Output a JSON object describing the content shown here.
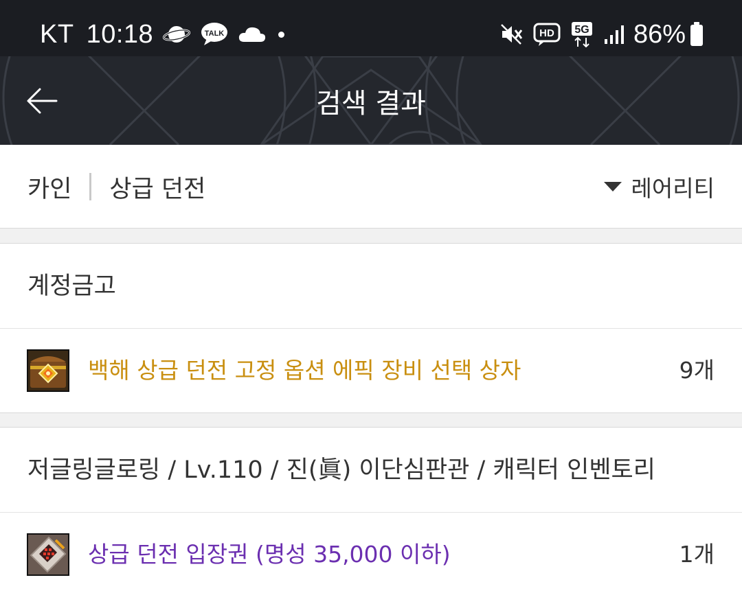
{
  "status_bar": {
    "carrier": "KT",
    "time": "10:18",
    "left_icons": [
      "planet-icon",
      "kakaotalk-icon",
      "cloud-icon"
    ],
    "kakao_label": "TALK",
    "right_icons": [
      "mute-icon",
      "hd-voice-icon",
      "5g-icon",
      "signal-icon"
    ],
    "hd_label": "HD",
    "network_label": "5G",
    "battery_percent": "86%"
  },
  "header": {
    "title": "검색 결과",
    "back_icon": "back-arrow-icon"
  },
  "filter": {
    "server": "카인",
    "category": "상급 던전",
    "sort_label": "레어리티"
  },
  "sections": [
    {
      "title": "계정금고",
      "items": [
        {
          "name": "백해 상급 던전 고정 옵션 에픽 장비 선택 상자",
          "count": "9개",
          "rarity_color": "#c98f10",
          "icon": "treasure-chest-icon"
        }
      ]
    },
    {
      "title": "저글링글로링 / Lv.110 / 진(眞) 이단심판관 / 캐릭터 인벤토리",
      "items": [
        {
          "name": "상급 던전 입장권 (명성 35,000 이하)",
          "count": "1개",
          "rarity_color": "#6b2fb0",
          "icon": "ticket-icon"
        }
      ]
    }
  ]
}
